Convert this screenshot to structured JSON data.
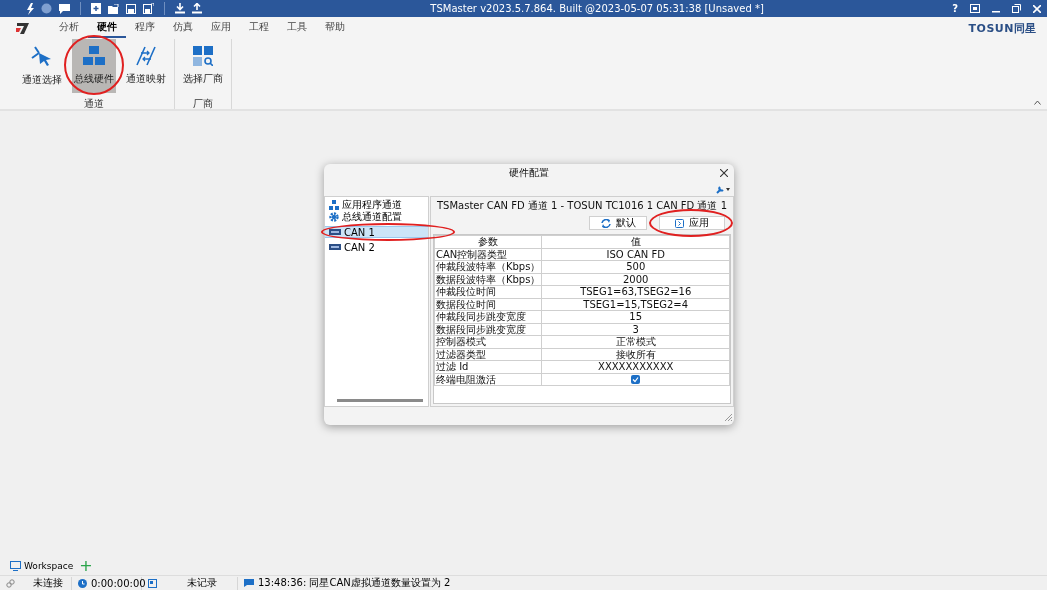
{
  "titlebar": {
    "title": "TSMaster v2023.5.7.864. Built @2023-05-07 05:31:38 [Unsaved *]",
    "help": "?"
  },
  "menu": {
    "tabs": [
      {
        "label": "分析",
        "selected": false
      },
      {
        "label": "硬件",
        "selected": true
      },
      {
        "label": "程序",
        "selected": false
      },
      {
        "label": "仿真",
        "selected": false
      },
      {
        "label": "应用",
        "selected": false
      },
      {
        "label": "工程",
        "selected": false
      },
      {
        "label": "工具",
        "selected": false
      },
      {
        "label": "帮助",
        "selected": false
      }
    ],
    "brand": "TOSUN同星"
  },
  "ribbon": {
    "groups": [
      {
        "label": "通道",
        "buttons": [
          {
            "label": "通道选择",
            "kind": "cursor",
            "selected": false,
            "circled": false
          },
          {
            "label": "总线硬件",
            "kind": "blocks",
            "selected": true,
            "circled": true
          },
          {
            "label": "通道映射",
            "kind": "mapping",
            "selected": false,
            "circled": false
          }
        ]
      },
      {
        "label": "厂商",
        "buttons": [
          {
            "label": "选择厂商",
            "kind": "grid-search",
            "selected": false,
            "circled": false
          }
        ]
      }
    ]
  },
  "dialog": {
    "title": "硬件配置",
    "tree": [
      {
        "label": "应用程序通道",
        "kind": "network",
        "selected": false,
        "circled": false
      },
      {
        "label": "总线通道配置",
        "kind": "gear",
        "selected": false,
        "circled": false
      },
      {
        "label": "CAN 1",
        "kind": "can",
        "selected": true,
        "circled": true
      },
      {
        "label": "CAN 2",
        "kind": "can",
        "selected": false,
        "circled": false
      }
    ],
    "group_title": "TSMaster CAN FD 通道 1 - TOSUN TC1016 1 CAN FD 通道 1",
    "buttons": [
      {
        "label": "默认",
        "kind": "refresh",
        "circled": false
      },
      {
        "label": "应用",
        "kind": "apply",
        "circled": true
      }
    ],
    "columns": [
      "参数",
      "值"
    ],
    "rows": [
      {
        "kind": "text",
        "param": "CAN控制器类型",
        "value": "ISO CAN FD"
      },
      {
        "kind": "text",
        "param": "仲裁段波特率（Kbps）",
        "value": "500"
      },
      {
        "kind": "text",
        "param": "数据段波特率（Kbps）",
        "value": "2000"
      },
      {
        "kind": "text",
        "param": "仲裁段位时间",
        "value": "TSEG1=63,TSEG2=16"
      },
      {
        "kind": "text",
        "param": "数据段位时间",
        "value": "TSEG1=15,TSEG2=4"
      },
      {
        "kind": "text",
        "param": "仲裁段同步跳变宽度",
        "value": "15"
      },
      {
        "kind": "text",
        "param": "数据段同步跳变宽度",
        "value": "3"
      },
      {
        "kind": "text",
        "param": "控制器模式",
        "value": "正常模式"
      },
      {
        "kind": "text",
        "param": "过滤器类型",
        "value": "接收所有"
      },
      {
        "kind": "text",
        "param": "过滤 Id",
        "value": "XXXXXXXXXXX"
      },
      {
        "kind": "checkbox",
        "param": "终端电阻激活",
        "checked": true
      }
    ]
  },
  "workspace": {
    "tab": "Workspace",
    "add": "+"
  },
  "status_bar": {
    "connection": "未连接",
    "time": "0:00:00:00",
    "recording": "未记录",
    "message": "13:48:36: 同星CAN虚拟通道数量设置为 2"
  }
}
